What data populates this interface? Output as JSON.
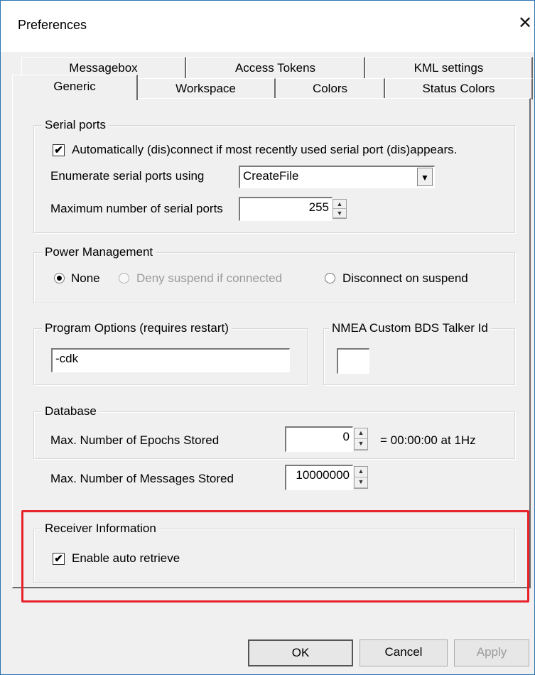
{
  "window": {
    "title": "Preferences",
    "close_glyph": "✕"
  },
  "tabs": {
    "back_row": [
      "Messagebox",
      "Access Tokens",
      "KML settings"
    ],
    "front_row": [
      "Generic",
      "Workspace",
      "Colors",
      "Status Colors"
    ],
    "active": "Generic"
  },
  "serial_ports": {
    "legend": "Serial ports",
    "auto_connect": {
      "label": "Automatically (dis)connect if most recently used serial port (dis)appears.",
      "checked": true
    },
    "enumerate_label": "Enumerate serial ports using",
    "enumerate_value": "CreateFile",
    "max_ports_label": "Maximum number of serial ports",
    "max_ports_value": "255"
  },
  "power_management": {
    "legend": "Power Management",
    "options": [
      "None",
      "Deny suspend if connected",
      "Disconnect on suspend"
    ],
    "selected": "None"
  },
  "program_options": {
    "legend": "Program Options (requires restart)",
    "value": "-cdk"
  },
  "nmea": {
    "legend": "NMEA Custom BDS Talker Id",
    "value": ""
  },
  "database": {
    "legend": "Database",
    "epochs_label": "Max. Number of Epochs Stored",
    "epochs_value": "0",
    "epochs_suffix": "= 00:00:00 at 1Hz",
    "messages_label": "Max. Number of Messages Stored",
    "messages_value": "10000000"
  },
  "receiver_info": {
    "legend": "Receiver Information",
    "auto_retrieve": {
      "label": "Enable auto retrieve",
      "checked": true
    },
    "highlight_color": "#e8222a"
  },
  "buttons": {
    "ok": "OK",
    "cancel": "Cancel",
    "apply": "Apply"
  },
  "icons": {
    "check": "✔",
    "dropdown": "▼",
    "spin_up": "▲",
    "spin_down": "▼"
  }
}
